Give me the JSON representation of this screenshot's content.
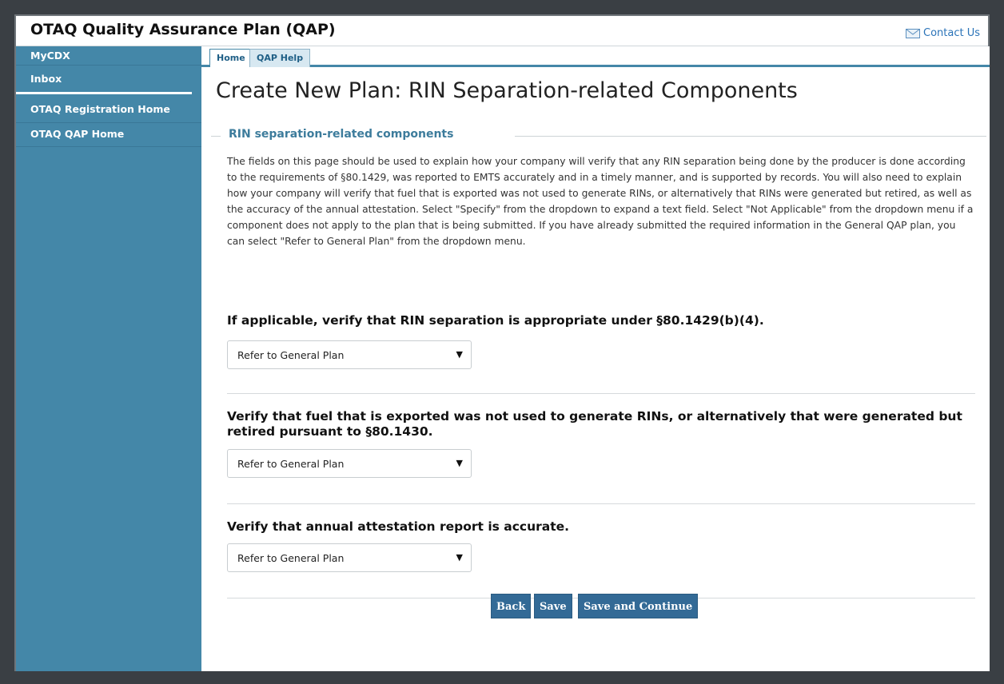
{
  "app": {
    "title": "OTAQ Quality Assurance Plan (QAP)",
    "contact_label": "Contact Us"
  },
  "sidebar": {
    "items": [
      {
        "label": "MyCDX"
      },
      {
        "label": "Inbox"
      },
      {
        "label": "OTAQ Registration Home"
      },
      {
        "label": "OTAQ QAP Home"
      }
    ]
  },
  "tabs": [
    {
      "label": "Home",
      "active": true
    },
    {
      "label": "QAP Help",
      "active": false
    }
  ],
  "page": {
    "title": "Create New Plan: RIN Separation-related Components",
    "section_label": "RIN separation-related components",
    "intro": "The fields on this page should be used to explain how your company will verify that any RIN separation being done by the producer is done according to the requirements of §80.1429, was reported to EMTS accurately and in a timely manner, and is supported by records. You will also need to explain how your company will verify that fuel that is exported was not used to generate RINs, or alternatively that RINs were generated but retired, as well as the accuracy of the annual attestation. Select \"Specify\" from the dropdown to expand a text field. Select \"Not Applicable\" from the dropdown menu if a component does not apply to the plan that is being submitted. If you have already submitted the required information in the General QAP plan, you can select \"Refer to General Plan\" from the dropdown menu."
  },
  "questions": [
    {
      "text": "If applicable, verify that RIN separation is appropriate under §80.1429(b)(4).",
      "selected": "Refer to General Plan"
    },
    {
      "text": "Verify that fuel that is exported was not used to generate RINs, or alternatively that were generated but retired pursuant to §80.1430.",
      "selected": "Refer to General Plan"
    },
    {
      "text": "Verify that annual attestation report is accurate.",
      "selected": "Refer to General Plan"
    }
  ],
  "buttons": {
    "back": "Back",
    "save": "Save",
    "save_continue": "Save and Continue"
  },
  "colors": {
    "sidebar": "#4487a8",
    "accent": "#336a96",
    "section": "#3d7c9c"
  }
}
